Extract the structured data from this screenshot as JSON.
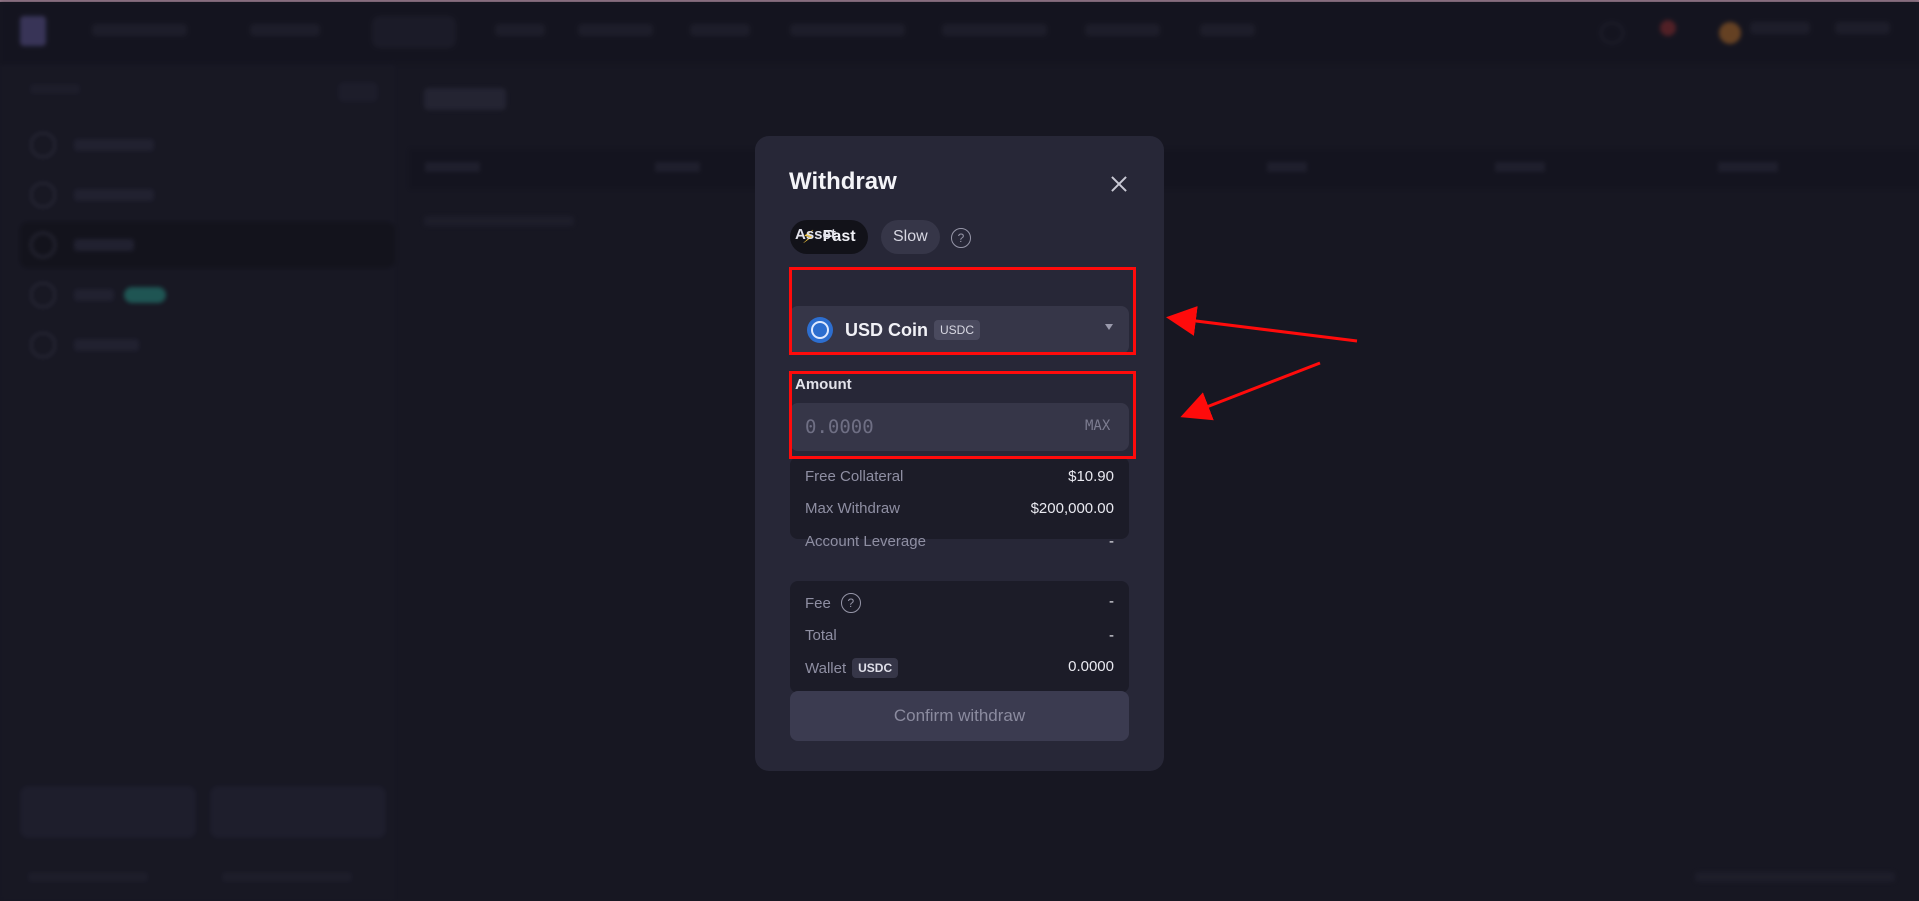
{
  "modal": {
    "title": "Withdraw",
    "tabs": {
      "fast": "Fast",
      "slow": "Slow",
      "help": "?"
    },
    "asset": {
      "label": "Asset",
      "name": "USD Coin",
      "ticker": "USDC"
    },
    "amount": {
      "label": "Amount",
      "placeholder": "0.0000",
      "max": "MAX"
    },
    "info": [
      {
        "key": "Free Collateral",
        "value": "$10.90"
      },
      {
        "key": "Max Withdraw",
        "value": "$200,000.00"
      },
      {
        "key": "Account Leverage",
        "value": "-"
      }
    ],
    "fees": {
      "fee_label": "Fee",
      "fee_value": "-",
      "total_label": "Total",
      "total_value": "-",
      "wallet_label": "Wallet",
      "wallet_ticker": "USDC",
      "wallet_value": "0.0000"
    },
    "confirm": "Confirm withdraw"
  },
  "annotation_color": "#ff0b0b",
  "colors": {
    "accent_fast": "#f3c83c",
    "modal_bg": "#272737",
    "page_bg": "#1b1b27"
  }
}
